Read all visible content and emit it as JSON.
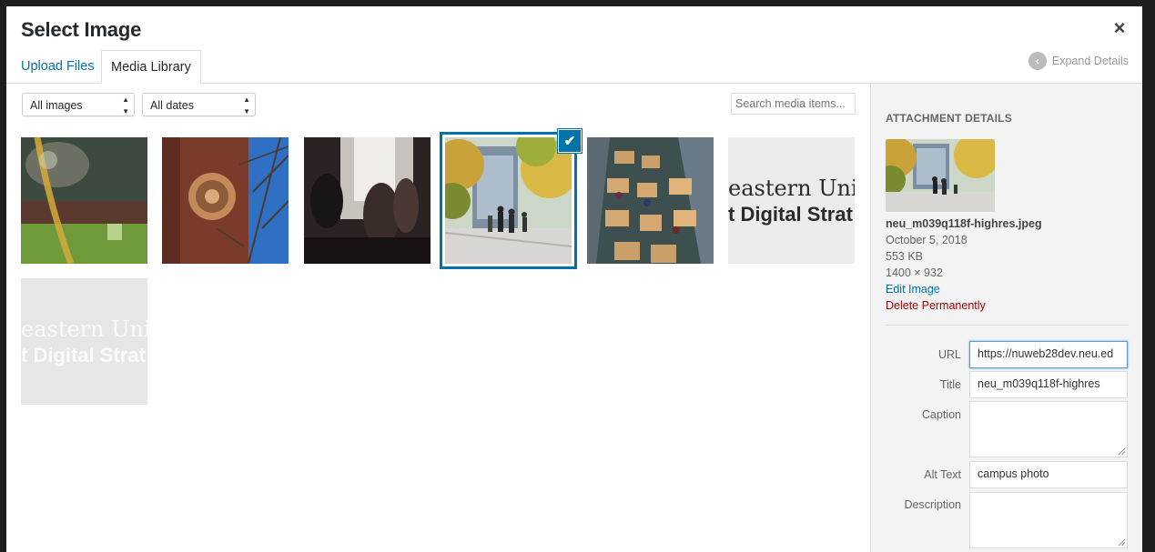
{
  "modal": {
    "title": "Select Image",
    "close_glyph": "×"
  },
  "tabs": [
    {
      "label": "Upload Files",
      "active": false
    },
    {
      "label": "Media Library",
      "active": true
    }
  ],
  "expand_details": {
    "label": "Expand Details",
    "icon": "chevron-left-icon"
  },
  "filters": {
    "type_selected": "All images",
    "date_selected": "All dates",
    "search_placeholder": "Search media items..."
  },
  "media_items": [
    {
      "name": "campus-lawn-photo",
      "selected": false
    },
    {
      "name": "brick-building-seal-photo",
      "selected": false
    },
    {
      "name": "silhouettes-window-photo",
      "selected": false
    },
    {
      "name": "campus-walkway-autumn-photo",
      "selected": true
    },
    {
      "name": "library-study-area-photo",
      "selected": false
    },
    {
      "name": "logo-text-image-1",
      "selected": false,
      "text_lines": [
        "eastern Uni",
        "t Digital Strat"
      ]
    },
    {
      "name": "logo-text-image-2",
      "selected": false,
      "text_lines": [
        "eastern Uni",
        "t Digital Strat"
      ]
    }
  ],
  "attachment": {
    "heading": "ATTACHMENT DETAILS",
    "filename": "neu_m039q118f-highres.jpeg",
    "date": "October 5, 2018",
    "size": "553 KB",
    "dimensions": "1400 × 932",
    "edit_link": "Edit Image",
    "delete_link": "Delete Permanently"
  },
  "fields": {
    "url_label": "URL",
    "url_value": "https://nuweb28dev.neu.ed",
    "title_label": "Title",
    "title_value": "neu_m039q118f-highres",
    "caption_label": "Caption",
    "caption_value": "",
    "alt_label": "Alt Text",
    "alt_value": "campus photo",
    "description_label": "Description",
    "description_value": ""
  },
  "colors": {
    "accent": "#0073aa",
    "delete": "#aa0000",
    "sidebar_bg": "#f3f3f3"
  }
}
